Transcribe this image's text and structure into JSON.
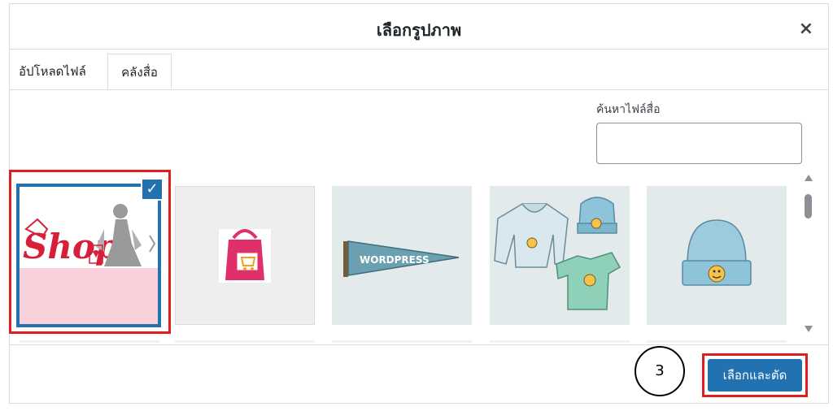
{
  "modal": {
    "title": "เลือกรูปภาพ",
    "close_label": "×"
  },
  "tabs": [
    {
      "label": "อัปโหลดไฟล์",
      "active": false
    },
    {
      "label": "คลังสื่อ",
      "active": true
    }
  ],
  "search": {
    "label": "ค้นหาไฟล์สื่อ",
    "value": ""
  },
  "media_items": [
    {
      "name": "shop-banner",
      "selected": true,
      "text": "Shop."
    },
    {
      "name": "shop-bag-logo",
      "selected": false
    },
    {
      "name": "wordpress-pennant",
      "selected": false,
      "text": "WORDPRESS"
    },
    {
      "name": "hoodie-beanie-tshirt",
      "selected": false
    },
    {
      "name": "beanie",
      "selected": false
    }
  ],
  "annotation": {
    "step": "3"
  },
  "footer": {
    "select_crop_label": "เลือกและตัด"
  },
  "colors": {
    "primary": "#2271b1",
    "highlight": "#e01e1e"
  }
}
